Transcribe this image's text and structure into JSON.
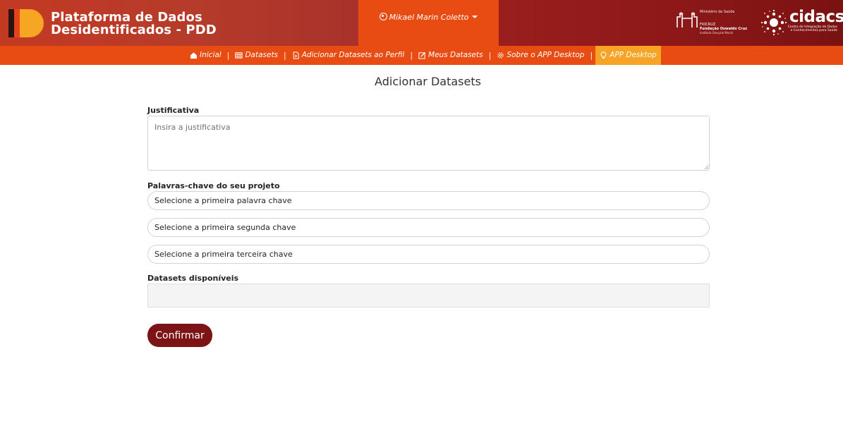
{
  "header": {
    "brand_line1": "Plataforma de Dados",
    "brand_line2": "Desidentificados - PDD",
    "user_name": "Mikael Marin Coletto",
    "ministry": {
      "line1": "Ministério da Saúde",
      "line2": "FIOCRUZ",
      "line3": "Fundação Oswaldo Cruz",
      "line4": "Instituto Gonçalo Moniz"
    },
    "cidacs": {
      "word": "cidacs",
      "sub1": "Centro de Integração de Dados",
      "sub2": "e Conhecimentos para Saúde"
    },
    "colors": {
      "brand_red": "#b53b2a",
      "orange": "#e84c13",
      "dark_red": "#8a1717",
      "active_tab": "#f7a325"
    }
  },
  "nav": {
    "items": [
      {
        "label": "Inicial",
        "icon": "home-icon"
      },
      {
        "label": "Datasets",
        "icon": "table-icon"
      },
      {
        "label": "Adicionar Datasets ao Perfil",
        "icon": "file-plus-icon"
      },
      {
        "label": "Meus Datasets",
        "icon": "edit-icon"
      },
      {
        "label": "Sobre o APP Desktop",
        "icon": "gear-icon"
      },
      {
        "label": "APP Desktop",
        "icon": "lightbulb-icon",
        "active": true
      }
    ],
    "separator": "|"
  },
  "main": {
    "title": "Adicionar Datasets",
    "justificativa_label": "Justificativa",
    "justificativa_placeholder": "Insira a justificativa",
    "keywords_label": "Palavras-chave do seu projeto",
    "keyword1": "Selecione a primeira palavra chave",
    "keyword2": "Selecione a primeira segunda chave",
    "keyword3": "Selecione a primeira terceira chave",
    "datasets_label": "Datasets disponíveis",
    "confirm_label": "Confirmar",
    "confirm_color": "#7c1315"
  }
}
